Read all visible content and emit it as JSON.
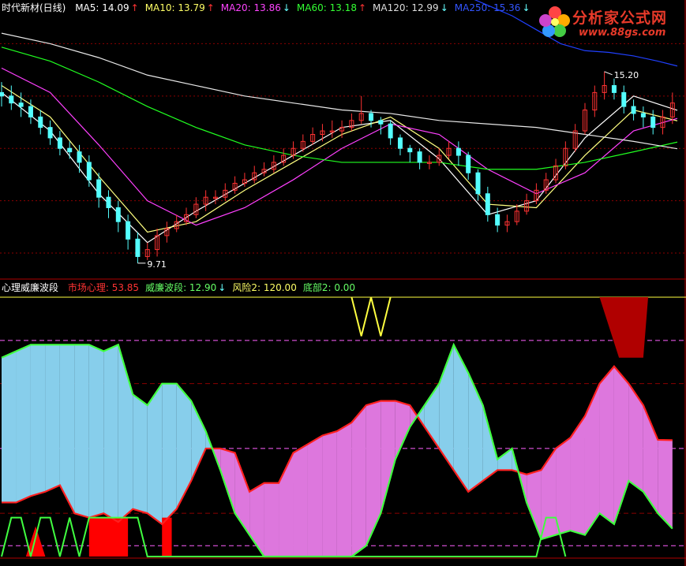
{
  "upper_header": {
    "title": "时代新材(日线)",
    "items": [
      {
        "label": "MA5: 14.09",
        "arrow": "↑",
        "color": "#ffffff"
      },
      {
        "label": "MA10: 13.79",
        "arrow": "↑",
        "color": "#ffff66"
      },
      {
        "label": "MA20: 13.86",
        "arrow": "↓",
        "color": "#ff44ff"
      },
      {
        "label": "MA60: 13.18",
        "arrow": "↑",
        "color": "#33ff33"
      },
      {
        "label": "MA120: 12.99",
        "arrow": "↓",
        "color": "#dddddd"
      },
      {
        "label": "MA250: 15.36",
        "arrow": "↓",
        "color": "#3355ff"
      }
    ]
  },
  "lower_header": {
    "title": "心理威廉波段",
    "items": [
      {
        "label": "市场心理: 53.85",
        "arrow": "",
        "color": "#ff3333"
      },
      {
        "label": "威廉波段: 12.90",
        "arrow": "↓",
        "color": "#66ff66"
      },
      {
        "label": "风险2: 120.00",
        "arrow": "",
        "color": "#ffff66"
      },
      {
        "label": "底部2: 0.00",
        "arrow": "",
        "color": "#66ff66"
      }
    ]
  },
  "logo": {
    "brand": "分析家公式网",
    "url": "www.88gs.com"
  },
  "colors": {
    "up": "#ff3232",
    "down": "#54ffff",
    "grid": "#8b0000",
    "sep": "#b00000",
    "ma5": "#ffffff",
    "ma10": "#ffff80",
    "ma20": "#ff40ff",
    "ma60": "#20ff20",
    "ma120": "#e8e8e8",
    "ma250": "#2040ff",
    "psych_fill": "#87ceeb",
    "will_fill": "#dd77dd",
    "psych_line": "#ff2020",
    "will_line": "#40ff40",
    "risk": "#ffff40",
    "risk_block": "#b00000",
    "bottom_fill": "#ff0000",
    "ref_line": "#ff60ff"
  },
  "price_annotations": [
    {
      "text": "15.20",
      "x": 57,
      "value": 15.2
    },
    {
      "text": "9.71",
      "x": 27,
      "value": 9.71
    }
  ],
  "chart_data": [
    {
      "type": "candlestick",
      "title": "时代新材(日线)",
      "ylim": [
        9.3,
        16.8
      ],
      "x_count": 140,
      "candles": {
        "x": [
          0,
          2,
          4,
          6,
          8,
          10,
          12,
          14,
          16,
          18,
          20,
          22,
          24,
          26,
          28,
          30,
          32,
          34,
          36,
          38,
          40,
          42,
          44,
          46,
          48,
          50,
          52,
          54,
          56,
          58,
          60,
          62,
          64,
          66,
          68,
          70,
          72,
          74,
          76,
          78,
          80,
          82,
          84,
          86,
          88,
          90,
          92,
          94,
          96,
          98,
          100,
          102,
          104,
          106,
          108,
          110,
          112,
          114,
          116,
          118,
          120,
          122,
          124,
          126,
          128,
          130,
          132,
          134,
          136,
          138
        ],
        "open": [
          14.6,
          14.5,
          14.3,
          14.2,
          13.9,
          13.6,
          13.3,
          13.0,
          12.9,
          12.6,
          12.1,
          11.6,
          11.3,
          10.9,
          10.4,
          9.9,
          10.1,
          10.5,
          10.7,
          10.9,
          11.1,
          11.4,
          11.6,
          11.6,
          11.8,
          12.0,
          12.1,
          12.3,
          12.4,
          12.6,
          12.8,
          13.0,
          13.2,
          13.4,
          13.5,
          13.5,
          13.6,
          13.8,
          14.0,
          13.8,
          13.7,
          13.3,
          13.0,
          12.9,
          12.6,
          12.6,
          12.8,
          13.0,
          12.8,
          12.3,
          11.7,
          11.1,
          10.8,
          10.9,
          11.2,
          11.5,
          11.8,
          12.1,
          12.5,
          13.0,
          13.5,
          14.1,
          14.6,
          14.8,
          14.6,
          14.2,
          14.0,
          13.9,
          13.6,
          13.9
        ],
        "close": [
          14.5,
          14.3,
          14.2,
          13.9,
          13.6,
          13.3,
          13.0,
          12.9,
          12.6,
          12.1,
          11.6,
          11.3,
          10.9,
          10.4,
          9.9,
          10.1,
          10.5,
          10.7,
          10.9,
          11.1,
          11.4,
          11.6,
          11.6,
          11.8,
          12.0,
          12.1,
          12.3,
          12.4,
          12.6,
          12.8,
          13.0,
          13.2,
          13.4,
          13.5,
          13.5,
          13.6,
          13.8,
          14.0,
          13.8,
          13.7,
          13.3,
          13.0,
          12.9,
          12.6,
          12.6,
          12.8,
          13.0,
          12.8,
          12.3,
          11.7,
          11.1,
          10.8,
          10.9,
          11.2,
          11.5,
          11.8,
          12.1,
          12.5,
          13.0,
          13.5,
          14.1,
          14.6,
          14.8,
          14.6,
          14.2,
          14.0,
          13.9,
          13.6,
          13.9,
          14.3
        ],
        "high": [
          14.9,
          14.8,
          14.6,
          14.4,
          14.1,
          13.8,
          13.5,
          13.2,
          13.1,
          12.8,
          12.3,
          11.8,
          11.5,
          11.1,
          10.6,
          10.3,
          10.7,
          10.9,
          11.1,
          11.3,
          11.6,
          11.8,
          11.8,
          12.0,
          12.2,
          12.3,
          12.5,
          12.6,
          12.8,
          13.0,
          13.2,
          13.4,
          13.6,
          13.7,
          13.8,
          13.8,
          14.0,
          14.5,
          14.1,
          13.9,
          13.8,
          13.4,
          13.1,
          13.0,
          12.8,
          13.0,
          13.2,
          13.2,
          12.9,
          12.4,
          11.9,
          11.3,
          11.1,
          11.4,
          11.7,
          12.0,
          12.3,
          12.7,
          13.2,
          13.7,
          14.3,
          14.8,
          15.2,
          15.0,
          14.8,
          14.4,
          14.2,
          14.1,
          14.1,
          14.6
        ],
        "low": [
          14.2,
          14.1,
          13.9,
          13.7,
          13.4,
          13.1,
          12.8,
          12.7,
          12.3,
          11.9,
          11.3,
          11.0,
          10.6,
          10.1,
          9.71,
          9.8,
          9.9,
          10.3,
          10.6,
          10.8,
          11.0,
          11.2,
          11.4,
          11.5,
          11.7,
          11.9,
          12.0,
          12.2,
          12.3,
          12.5,
          12.7,
          12.9,
          13.1,
          13.2,
          13.3,
          13.3,
          13.5,
          13.7,
          13.6,
          13.4,
          13.1,
          12.8,
          12.6,
          12.4,
          12.4,
          12.5,
          12.7,
          12.5,
          12.1,
          11.5,
          10.9,
          10.6,
          10.6,
          10.8,
          11.1,
          11.4,
          11.7,
          12.0,
          12.4,
          12.9,
          13.4,
          13.9,
          14.4,
          14.4,
          14.0,
          13.8,
          13.6,
          13.4,
          13.4,
          13.7
        ]
      },
      "ma_series": [
        {
          "name": "MA5",
          "x": [
            0,
            10,
            20,
            30,
            40,
            50,
            60,
            70,
            80,
            90,
            100,
            110,
            120,
            130,
            139
          ],
          "values": [
            14.6,
            13.5,
            11.7,
            10.3,
            11.2,
            12.0,
            12.8,
            13.6,
            13.8,
            12.7,
            11.1,
            11.5,
            13.3,
            14.5,
            14.09
          ]
        },
        {
          "name": "MA10",
          "x": [
            0,
            10,
            20,
            30,
            40,
            50,
            60,
            70,
            80,
            90,
            100,
            110,
            120,
            130,
            139
          ],
          "values": [
            14.8,
            13.9,
            12.2,
            10.6,
            10.9,
            11.8,
            12.6,
            13.4,
            13.9,
            13.0,
            11.4,
            11.3,
            12.8,
            14.1,
            13.79
          ]
        },
        {
          "name": "MA20",
          "x": [
            0,
            10,
            20,
            30,
            40,
            50,
            60,
            70,
            80,
            90,
            100,
            110,
            120,
            130,
            139
          ],
          "values": [
            15.3,
            14.6,
            13.1,
            11.5,
            10.8,
            11.3,
            12.1,
            13.0,
            13.7,
            13.4,
            12.4,
            11.7,
            12.3,
            13.5,
            13.86
          ]
        },
        {
          "name": "MA60",
          "x": [
            0,
            10,
            20,
            30,
            40,
            50,
            60,
            70,
            80,
            90,
            100,
            110,
            120,
            130,
            139
          ],
          "values": [
            15.9,
            15.5,
            14.9,
            14.2,
            13.6,
            13.1,
            12.8,
            12.6,
            12.6,
            12.6,
            12.4,
            12.4,
            12.6,
            12.9,
            13.18
          ]
        },
        {
          "name": "MA120",
          "x": [
            0,
            10,
            20,
            30,
            40,
            50,
            60,
            70,
            80,
            90,
            100,
            110,
            120,
            130,
            139
          ],
          "values": [
            16.3,
            16.0,
            15.6,
            15.1,
            14.8,
            14.5,
            14.3,
            14.1,
            14.0,
            13.8,
            13.7,
            13.6,
            13.4,
            13.2,
            12.99
          ]
        },
        {
          "name": "MA250",
          "x": [
            95,
            100,
            105,
            110,
            115,
            120,
            125,
            130,
            135,
            139
          ],
          "values": [
            17.4,
            17.1,
            16.8,
            16.4,
            16.0,
            15.8,
            15.75,
            15.65,
            15.5,
            15.36
          ]
        }
      ]
    },
    {
      "type": "area",
      "title": "心理威廉波段",
      "ylim": [
        0,
        120
      ],
      "ref_lines": [
        100,
        80,
        50,
        20,
        5
      ],
      "series": [
        {
          "name": "市场心理",
          "x": [
            0,
            3,
            6,
            9,
            12,
            15,
            18,
            21,
            24,
            27,
            30,
            33,
            36,
            39,
            42,
            45,
            48,
            51,
            54,
            57,
            60,
            63,
            66,
            69,
            72,
            75,
            78,
            81,
            84,
            87,
            90,
            93,
            96,
            99,
            102,
            105,
            108,
            111,
            114,
            117,
            120,
            123,
            126,
            129,
            132,
            135,
            138
          ],
          "values": [
            25,
            25,
            28,
            30,
            33,
            20,
            18,
            20,
            16,
            22,
            20,
            15,
            22,
            35,
            50,
            50,
            48,
            30,
            34,
            34,
            48,
            52,
            56,
            58,
            62,
            70,
            72,
            72,
            70,
            60,
            50,
            40,
            30,
            35,
            40,
            40,
            38,
            40,
            50,
            55,
            65,
            80,
            88,
            80,
            70,
            54,
            53.85
          ]
        },
        {
          "name": "威廉波段",
          "x": [
            0,
            3,
            6,
            9,
            12,
            15,
            18,
            21,
            24,
            27,
            30,
            33,
            36,
            39,
            42,
            45,
            48,
            51,
            54,
            57,
            60,
            63,
            66,
            69,
            72,
            75,
            78,
            81,
            84,
            87,
            90,
            93,
            96,
            99,
            102,
            105,
            108,
            111,
            114,
            117,
            120,
            123,
            126,
            129,
            132,
            135,
            138
          ],
          "values": [
            92,
            95,
            98,
            98,
            98,
            98,
            98,
            95,
            98,
            75,
            70,
            80,
            80,
            72,
            58,
            40,
            20,
            10,
            0,
            -5,
            -8,
            -5,
            -5,
            -5,
            -8,
            5,
            20,
            45,
            60,
            70,
            80,
            98,
            85,
            70,
            45,
            50,
            25,
            8,
            10,
            12,
            10,
            20,
            15,
            35,
            30,
            20,
            12.9
          ]
        },
        {
          "name": "风险2",
          "type": "line",
          "x": [
            72,
            74,
            76,
            78,
            80
          ],
          "values": [
            120,
            102,
            120,
            102,
            120
          ]
        },
        {
          "name": "底部2",
          "type": "step",
          "x": [
            0,
            2,
            4,
            6,
            8,
            10,
            12,
            14,
            16,
            18,
            20,
            22,
            24,
            26,
            28,
            30,
            32,
            34,
            36,
            38,
            40,
            42,
            44,
            46,
            110,
            112,
            114,
            116
          ],
          "values": [
            0,
            18,
            18,
            0,
            18,
            18,
            0,
            18,
            0,
            18,
            18,
            18,
            18,
            18,
            18,
            0,
            0,
            0,
            0,
            0,
            0,
            0,
            0,
            0,
            0,
            18,
            18,
            0
          ]
        }
      ]
    }
  ]
}
